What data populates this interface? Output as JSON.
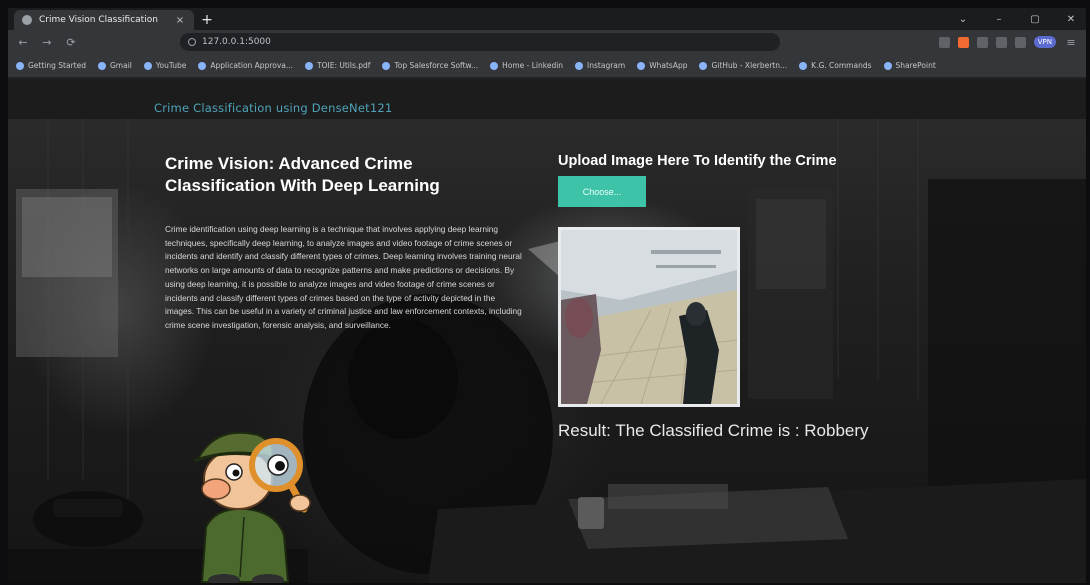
{
  "browser": {
    "tab_title": "Crime Vision Classification",
    "tab_close": "×",
    "new_tab": "+",
    "url": "127.0.0.1:5000",
    "vpn_label": "VPN",
    "window_controls": {
      "minimize": "–",
      "maximize": "▢",
      "close": "✕"
    },
    "nav": {
      "back": "←",
      "forward": "→",
      "reload": "⟳"
    },
    "bookmarks": [
      "Getting Started",
      "Gmail",
      "YouTube",
      "Application Approva...",
      "TOIE: Utils.pdf",
      "Top Salesforce Softw...",
      "Home - Linkedin",
      "Instagram",
      "WhatsApp",
      "GitHub - Xlerbertn...",
      "K.G. Commands",
      "SharePoint"
    ]
  },
  "navbar": {
    "brand": "Crime Classification using DenseNet121"
  },
  "hero": {
    "heading": "Crime Vision: Advanced Crime Classification With Deep Learning",
    "description": "Crime identification using deep learning is a technique that involves applying deep learning techniques, specifically deep learning, to analyze images and video footage of crime scenes or incidents and identify and classify different types of crimes. Deep learning involves training neural networks on large amounts of data to recognize patterns and make predictions or decisions. By using deep learning, it is possible to analyze images and video footage of crime scenes or incidents and classify different types of crimes based on the type of activity depicted in the images. This can be useful in a variety of criminal justice and law enforcement contexts, including crime scene investigation, forensic analysis, and surveillance."
  },
  "upload": {
    "title": "Upload Image Here To Identify the Crime",
    "choose_label": "Choose...",
    "result_label": "Result: The Classified Crime is : Robbery"
  },
  "colors": {
    "accent_button": "#3fc3a8",
    "brand_text": "#4fa3b8"
  }
}
